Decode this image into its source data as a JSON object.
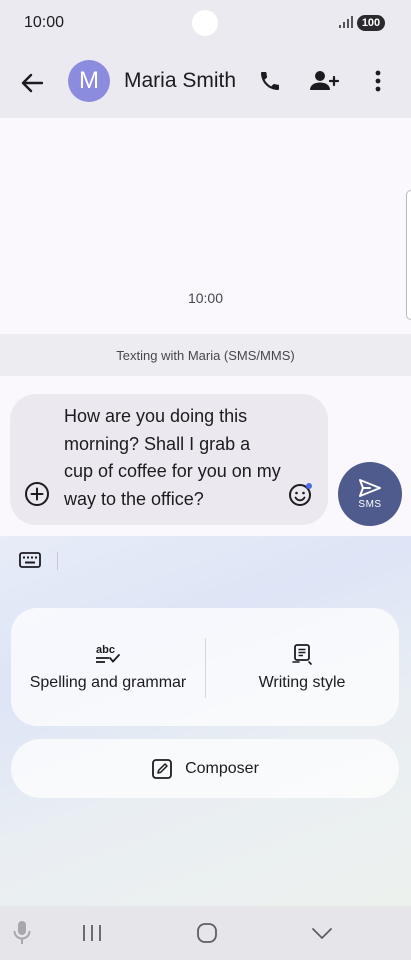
{
  "status_bar": {
    "time": "10:00",
    "battery": "100"
  },
  "app_bar": {
    "avatar_letter": "M",
    "contact_name": "Maria Smith",
    "icons": [
      "back-arrow-icon",
      "phone-icon",
      "add-contact-icon",
      "more-vert-icon"
    ]
  },
  "conversation": {
    "timestamp": "10:00"
  },
  "banner": {
    "text": "Texting with Maria (SMS/MMS)"
  },
  "composer": {
    "message_text": "How are you doing this morning? Shall I grab a cup of coffee for you on my way to the office?",
    "send_label": "SMS"
  },
  "writing_tools": {
    "spelling_label": "Spelling and grammar",
    "spelling_icon_text": "abc",
    "style_label": "Writing style",
    "composer_label": "Composer"
  },
  "colors": {
    "send_button": "#4e5b8c",
    "avatar": "#8c8cdf",
    "emoji_badge": "#4c6ee0"
  }
}
